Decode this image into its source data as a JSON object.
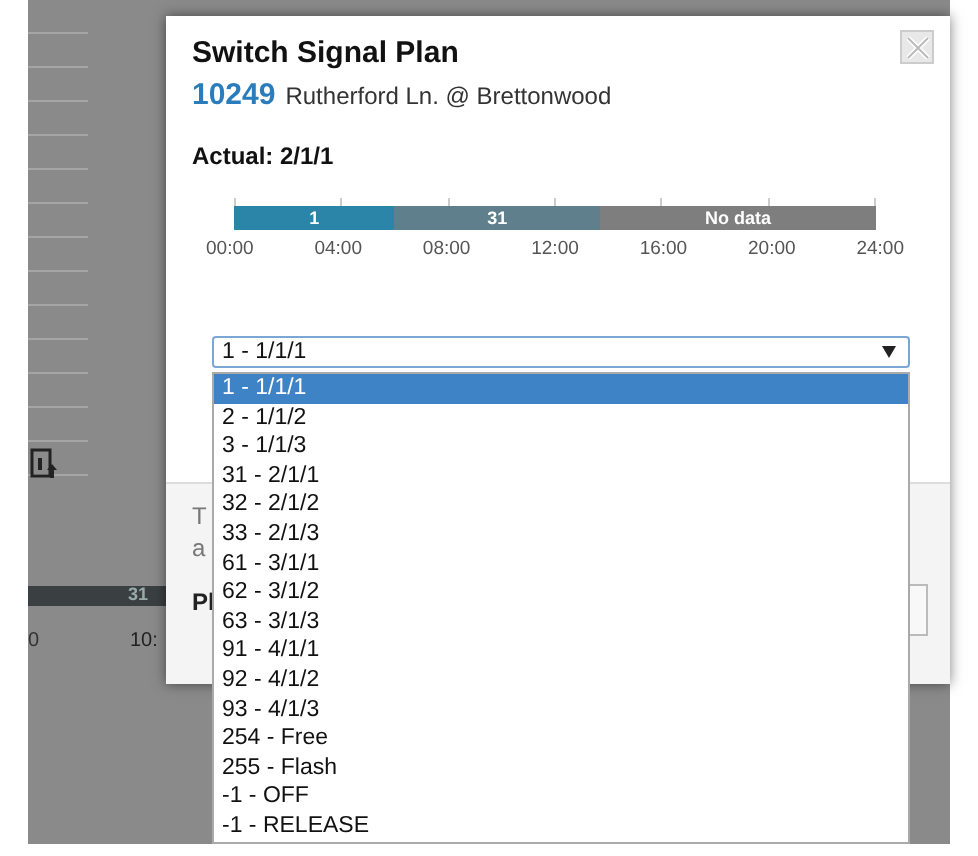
{
  "background": {
    "timeline_label": "31",
    "time_labels": [
      "0",
      "10:"
    ]
  },
  "dialog": {
    "title": "Switch Signal Plan",
    "signal_id": "10249",
    "intersection": "Rutherford Ln. @ Brettonwood",
    "actual": "Actual: 2/1/1",
    "timeline": {
      "segments": [
        {
          "label": "1",
          "color": "#2b85a9",
          "level": 0.25
        },
        {
          "label": "31",
          "color": "#5f7f8d",
          "level": 0.32
        },
        {
          "label": "No data",
          "color": "#7e7e7e",
          "level": 0.43
        }
      ],
      "ticks": [
        "00:00",
        "04:00",
        "08:00",
        "12:00",
        "16:00",
        "20:00",
        "24:00"
      ]
    },
    "footer_fragments": [
      "T",
      "a"
    ],
    "footer_label": "Pl",
    "plan_select": {
      "value": "1 - 1/1/1",
      "expanded": true,
      "options": [
        {
          "label": "1 - 1/1/1",
          "selected": true
        },
        {
          "label": "2 - 1/1/2",
          "selected": false
        },
        {
          "label": "3 - 1/1/3",
          "selected": false
        },
        {
          "label": "31 - 2/1/1",
          "selected": false
        },
        {
          "label": "32 - 2/1/2",
          "selected": false
        },
        {
          "label": "33 - 2/1/3",
          "selected": false
        },
        {
          "label": "61 - 3/1/1",
          "selected": false
        },
        {
          "label": "62 - 3/1/2",
          "selected": false
        },
        {
          "label": "63 - 3/1/3",
          "selected": false
        },
        {
          "label": "91 - 4/1/1",
          "selected": false
        },
        {
          "label": "92 - 4/1/2",
          "selected": false
        },
        {
          "label": "93 - 4/1/3",
          "selected": false
        },
        {
          "label": "254 - Free",
          "selected": false
        },
        {
          "label": "255 - Flash",
          "selected": false
        },
        {
          "label": "-1 - OFF",
          "selected": false
        },
        {
          "label": "-1 - RELEASE",
          "selected": false
        }
      ]
    }
  }
}
